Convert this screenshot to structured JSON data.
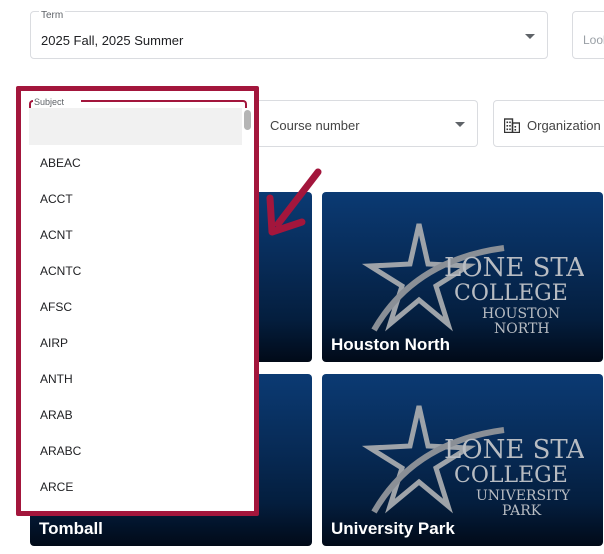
{
  "term": {
    "label": "Term",
    "value": "2025 Fall, 2025 Summer"
  },
  "lookup": {
    "placeholder": "Lool"
  },
  "course": {
    "placeholder": "Course number"
  },
  "organization": {
    "label": "Organization"
  },
  "subject": {
    "label": "Subject",
    "options": [
      "ABEAC",
      "ACCT",
      "ACNT",
      "ACNTC",
      "AFSC",
      "AIRP",
      "ANTH",
      "ARAB",
      "ARABC",
      "ARCE"
    ]
  },
  "campuses": {
    "houston_north": {
      "name": "Houston North",
      "logo_line1": "LONE STAR",
      "logo_line2": "COLLEGE",
      "logo_sub1": "HOUSTON",
      "logo_sub2": "NORTH"
    },
    "university_park": {
      "name": "University Park",
      "logo_line1": "LONE STAR",
      "logo_line2": "COLLEGE",
      "logo_sub1": "UNIVERSITY",
      "logo_sub2": "PARK"
    },
    "tomball": {
      "name": "Tomball"
    }
  },
  "colors": {
    "highlight": "#a3163c",
    "card_top": "#0b3a73",
    "card_bottom": "#010a18"
  }
}
